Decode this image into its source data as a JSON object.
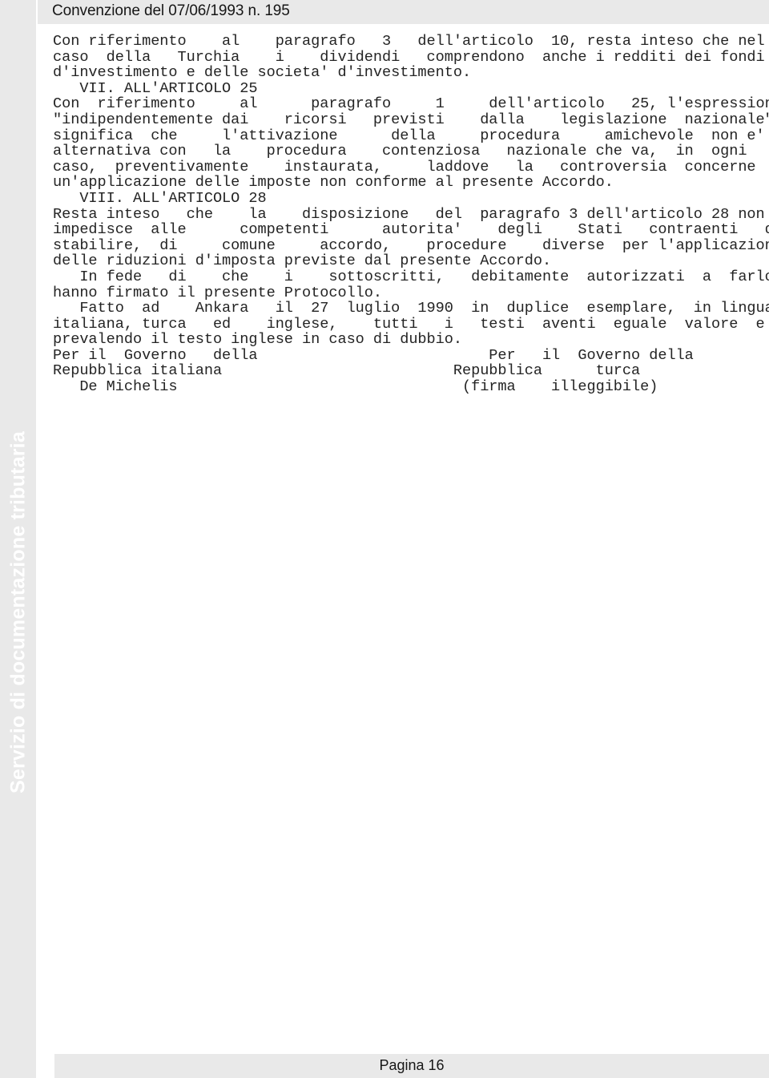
{
  "header": {
    "title": "Convenzione del 07/06/1993 n. 195"
  },
  "sidebar": {
    "watermark": "Servizio di documentazione tributaria"
  },
  "footer": {
    "page_label": "Pagina 16"
  },
  "document": {
    "lines": [
      "Con riferimento    al    paragrafo   3   dell'articolo  10, resta inteso che nel",
      "caso  della   Turchia    i    dividendi   comprendono  anche i redditi dei fondi",
      "d'investimento e delle societa' d'investimento.",
      "   VII. ALL'ARTICOLO 25",
      "Con  riferimento     al      paragrafo     1     dell'articolo   25, l'espressione",
      "\"indipendentemente dai    ricorsi   previsti    dalla    legislazione  nazionale\"",
      "significa  che     l'attivazione      della     procedura     amichevole  non e' in",
      "alternativa con   la    procedura    contenziosa   nazionale che va,  in  ogni",
      "caso,  preventivamente    instaurata,     laddove   la   controversia  concerne",
      "un'applicazione delle imposte non conforme al presente Accordo.",
      "   VIII. ALL'ARTICOLO 28",
      "Resta inteso   che    la    disposizione   del  paragrafo 3 dell'articolo 28 non",
      "impedisce  alle      competenti      autorita'    degli    Stati   contraenti   di",
      "stabilire,  di     comune     accordo,    procedure    diverse  per l'applicazione",
      "delle riduzioni d'imposta previste dal presente Accordo.",
      "   In fede   di    che    i    sottoscritti,   debitamente  autorizzati  a  farlo,",
      "hanno firmato il presente Protocollo.",
      "   Fatto  ad    Ankara   il  27  luglio  1990  in  duplice  esemplare,  in lingua",
      "italiana, turca   ed    inglese,    tutti   i   testi  aventi  eguale  valore  e",
      "prevalendo il testo inglese in caso di dubbio.",
      "Per il  Governo   della                          Per   il  Governo della",
      "Repubblica italiana                          Repubblica      turca",
      "   De Michelis                                (firma    illeggibile)"
    ]
  }
}
